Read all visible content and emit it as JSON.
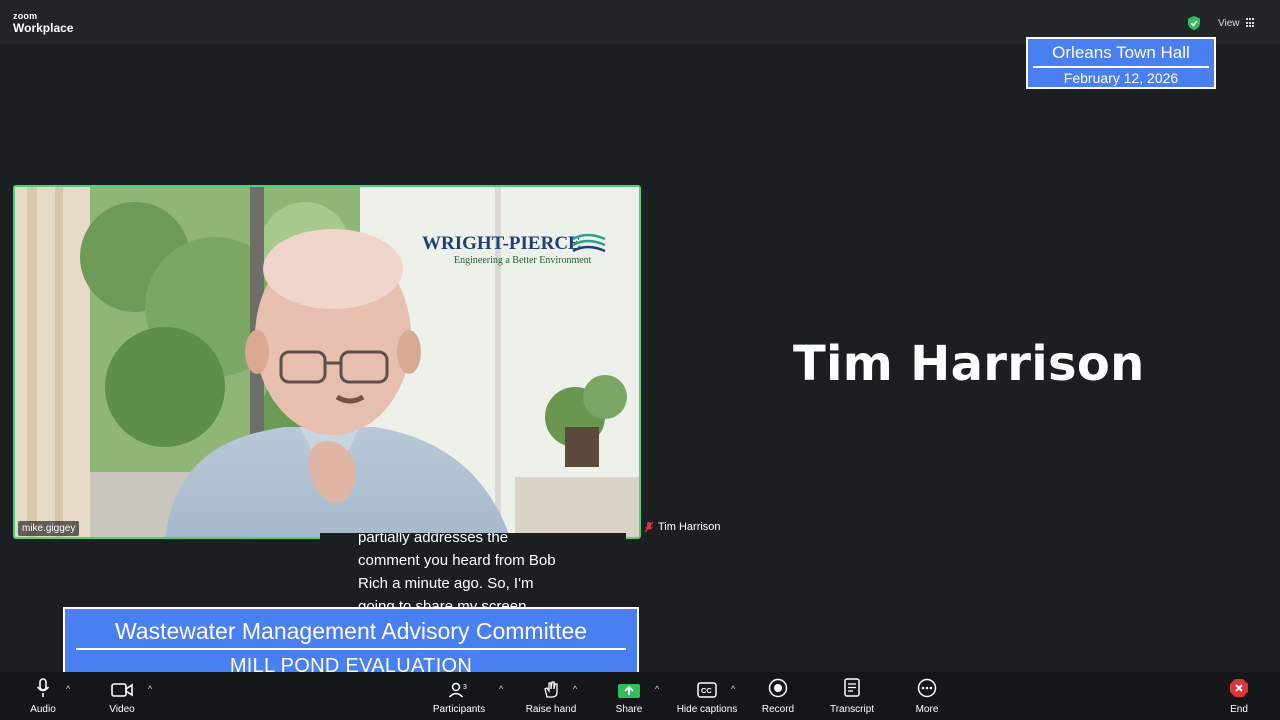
{
  "app": {
    "brand_top": "zoom",
    "brand_bottom": "Workplace"
  },
  "topbar": {
    "view_label": "View",
    "icons": [
      "shield-check-icon",
      "grid-icon"
    ]
  },
  "overlay_location": {
    "title": "Orleans Town Hall",
    "date": "February 12, 2026"
  },
  "video_tile": {
    "participant_label": "mike.giggey",
    "logo_main": "WRIGHT-PIERCE",
    "logo_tagline": "Engineering a Better Environment"
  },
  "active_speaker": {
    "name": "Tim Harrison",
    "label": "Tim Harrison",
    "muted": true
  },
  "captions": {
    "lines": [
      "partially addresses the",
      "comment you heard from Bob",
      "Rich a minute ago. So, I'm",
      "going to share my screen"
    ]
  },
  "lower_third": {
    "title": "Wastewater Management Advisory Committee",
    "subtitle": "MILL POND EVALUATION"
  },
  "toolbar": {
    "audio": "Audio",
    "video": "Video",
    "participants": "Participants",
    "participants_count": "3",
    "raise_hand": "Raise hand",
    "share": "Share",
    "hide_captions": "Hide captions",
    "record": "Record",
    "transcript": "Transcript",
    "more": "More",
    "end": "End"
  },
  "colors": {
    "background": "#1c1f21",
    "overlay_blue": "#4a7ff2",
    "active_border": "#48d27a",
    "share_green": "#2fbf5b",
    "end_red": "#e0343c"
  }
}
